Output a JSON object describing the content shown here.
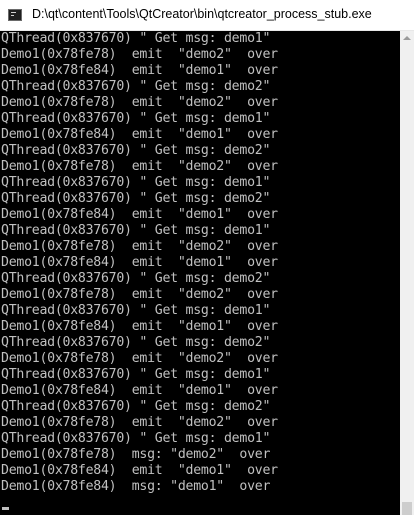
{
  "window": {
    "title": "D:\\qt\\content\\Tools\\QtCreator\\bin\\qtcreator_process_stub.exe"
  },
  "console": {
    "lines": [
      "QThread(0x837670) \" Get msg: demo1\"",
      "Demo1(0x78fe78)  emit  \"demo2\"  over",
      "Demo1(0x78fe84)  emit  \"demo1\"  over",
      "QThread(0x837670) \" Get msg: demo2\"",
      "Demo1(0x78fe78)  emit  \"demo2\"  over",
      "QThread(0x837670) \" Get msg: demo1\"",
      "Demo1(0x78fe84)  emit  \"demo1\"  over",
      "QThread(0x837670) \" Get msg: demo2\"",
      "Demo1(0x78fe78)  emit  \"demo2\"  over",
      "QThread(0x837670) \" Get msg: demo1\"",
      "QThread(0x837670) \" Get msg: demo2\"",
      "Demo1(0x78fe84)  emit  \"demo1\"  over",
      "QThread(0x837670) \" Get msg: demo1\"",
      "Demo1(0x78fe78)  emit  \"demo2\"  over",
      "Demo1(0x78fe84)  emit  \"demo1\"  over",
      "QThread(0x837670) \" Get msg: demo2\"",
      "Demo1(0x78fe78)  emit  \"demo2\"  over",
      "QThread(0x837670) \" Get msg: demo1\"",
      "Demo1(0x78fe84)  emit  \"demo1\"  over",
      "QThread(0x837670) \" Get msg: demo2\"",
      "Demo1(0x78fe78)  emit  \"demo2\"  over",
      "QThread(0x837670) \" Get msg: demo1\"",
      "Demo1(0x78fe84)  emit  \"demo1\"  over",
      "QThread(0x837670) \" Get msg: demo2\"",
      "Demo1(0x78fe78)  emit  \"demo2\"  over",
      "QThread(0x837670) \" Get msg: demo1\"",
      "Demo1(0x78fe78)  msg: \"demo2\"  over",
      "Demo1(0x78fe84)  emit  \"demo1\"  over",
      "Demo1(0x78fe84)  msg: \"demo1\"  over"
    ]
  },
  "colors": {
    "console_background": "#000000",
    "console_text": "#c0c0c0",
    "titlebar_background": "#ffffff"
  }
}
